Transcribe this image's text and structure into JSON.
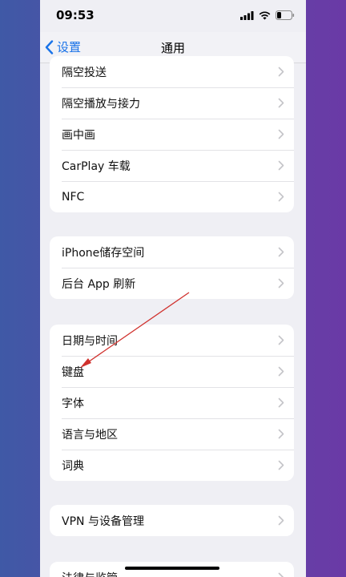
{
  "status_bar": {
    "time": "09:53"
  },
  "nav": {
    "back_label": "设置",
    "title": "通用"
  },
  "groups": [
    {
      "items": [
        {
          "label": "隔空投送"
        },
        {
          "label": "隔空播放与接力"
        },
        {
          "label": "画中画"
        },
        {
          "label": "CarPlay 车载"
        },
        {
          "label": "NFC"
        }
      ]
    },
    {
      "items": [
        {
          "label": "iPhone储存空间"
        },
        {
          "label": "后台 App 刷新"
        }
      ]
    },
    {
      "items": [
        {
          "label": "日期与时间"
        },
        {
          "label": "键盘"
        },
        {
          "label": "字体"
        },
        {
          "label": "语言与地区"
        },
        {
          "label": "词典"
        }
      ]
    },
    {
      "items": [
        {
          "label": "VPN 与设备管理"
        }
      ]
    },
    {
      "items": [
        {
          "label": "法律与监管"
        }
      ]
    }
  ],
  "colors": {
    "accent": "#1a73e8",
    "annotation_arrow": "#d0312d",
    "chevron": "#c4c4c8"
  }
}
